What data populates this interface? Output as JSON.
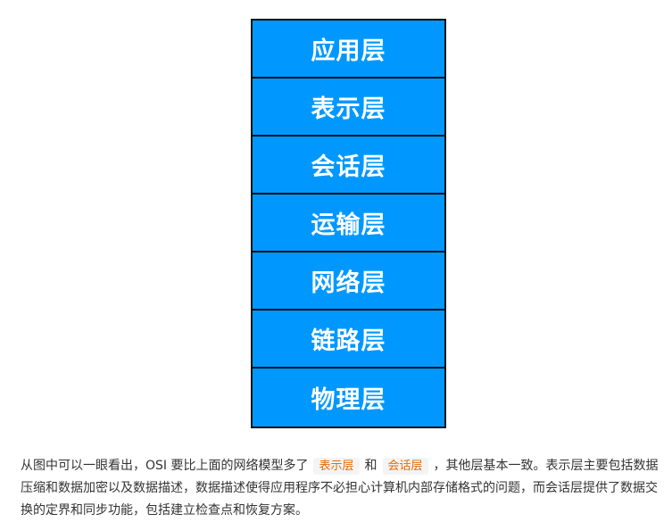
{
  "diagram": {
    "layers": [
      {
        "label": "应用层"
      },
      {
        "label": "表示层"
      },
      {
        "label": "会话层"
      },
      {
        "label": "运输层"
      },
      {
        "label": "网络层"
      },
      {
        "label": "链路层"
      },
      {
        "label": "物理层"
      }
    ],
    "colors": {
      "box_fill": "#0098ff",
      "box_border": "#111111",
      "label_text": "#ffffff"
    }
  },
  "caption": {
    "part1": "从图中可以一眼看出，OSI 要比上面的网络模型多了",
    "code1": "表示层",
    "part2": "和",
    "code2": "会话层",
    "part3": "，其他层基本一致。表示层主要包括数据压缩和数据加密以及数据描述，数据描述使得应用程序不必担心计算机内部存储格式的问题，而会话层提供了数据交换的定界和同步功能，包括建立检查点和恢复方案。",
    "code_color": "#e96900",
    "code_background": "#f4f4f4"
  }
}
